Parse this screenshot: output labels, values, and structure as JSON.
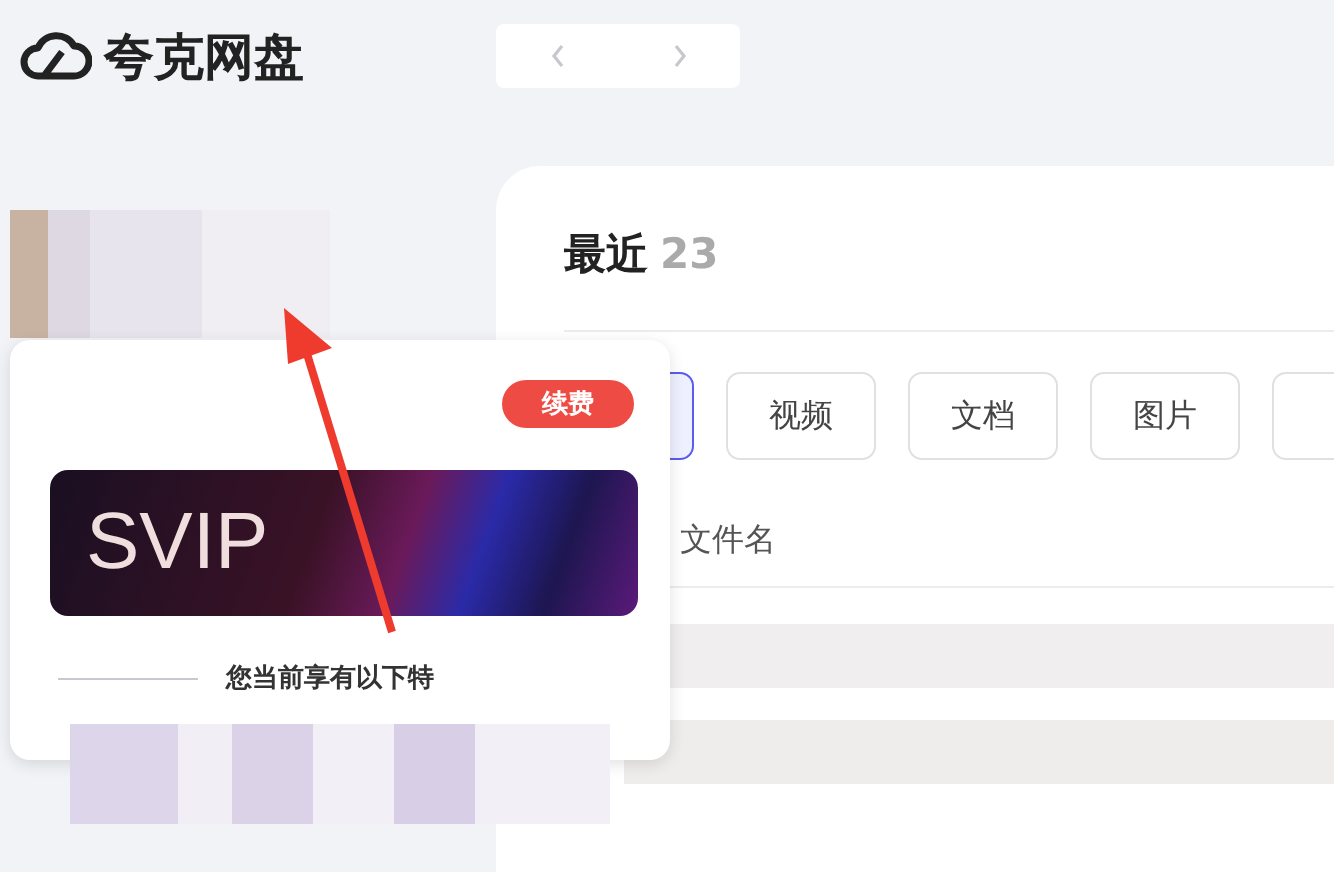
{
  "app": {
    "title": "夸克网盘"
  },
  "recent": {
    "title": "最近",
    "count": "23"
  },
  "filters": [
    {
      "selected": true
    },
    {
      "label": "视频",
      "selected": false
    },
    {
      "label": "文档",
      "selected": false
    },
    {
      "label": "图片",
      "selected": false
    },
    {
      "selected": false
    }
  ],
  "table": {
    "columns": [
      "文件名"
    ]
  },
  "popup": {
    "renew_button": "续费",
    "banner_text": "SVIP",
    "benefits_heading": "您当前享有以下特"
  }
}
